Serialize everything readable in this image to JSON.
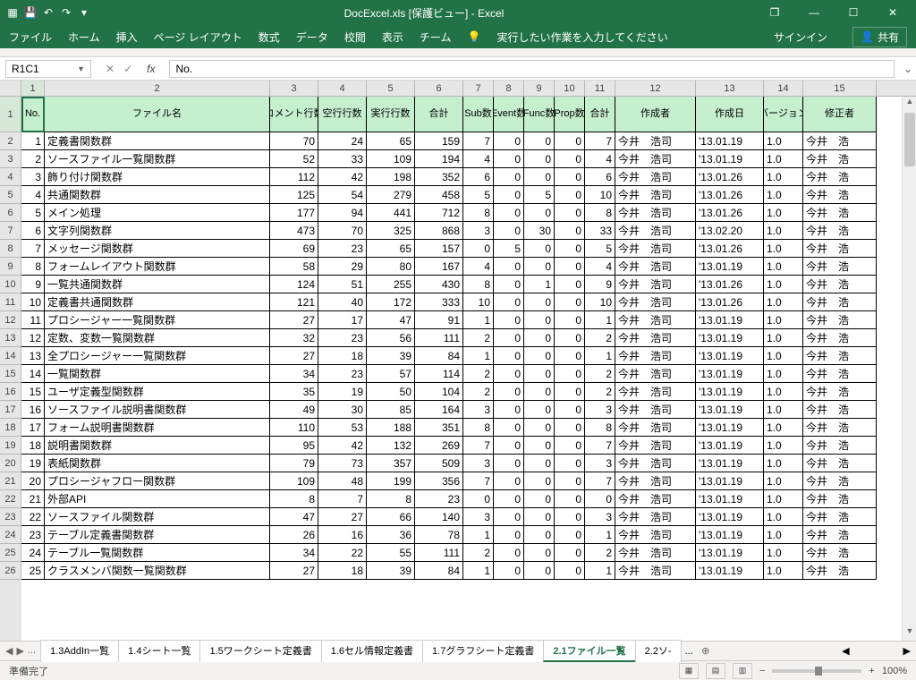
{
  "title": "DocExcel.xls  [保護ビュー] - Excel",
  "window": {
    "restore": "❐",
    "minimize": "—",
    "maximize": "☐",
    "close": "✕"
  },
  "qat": {
    "save": "💾",
    "undo": "↶",
    "redo": "↷",
    "dropdown": "▾"
  },
  "ribbon": {
    "tabs": [
      "ファイル",
      "ホーム",
      "挿入",
      "ページ レイアウト",
      "数式",
      "データ",
      "校閲",
      "表示",
      "チーム"
    ],
    "tell_me_icon": "💡",
    "tell_me": "実行したい作業を入力してください",
    "signin": "サインイン",
    "share_icon": "👤",
    "share": "共有"
  },
  "namebox": "R1C1",
  "fx": {
    "cancel": "✕",
    "enter": "✓",
    "label": "fx"
  },
  "formula": "No.",
  "col_labels": [
    "1",
    "2",
    "3",
    "4",
    "5",
    "6",
    "7",
    "8",
    "9",
    "10",
    "11",
    "12",
    "13",
    "14",
    "15"
  ],
  "headers": {
    "no": "No.",
    "name": "ファイル名",
    "comment": "コメント行数",
    "empty": "空行行数",
    "exec": "実行行数",
    "total": "合計",
    "sub": "Sub数",
    "event": "Event数",
    "func": "Func数",
    "prop": "Prop数",
    "total2": "合計",
    "author": "作成者",
    "date": "作成日",
    "ver": "バージョン",
    "modifier": "修正者"
  },
  "chart_data": {
    "type": "table",
    "columns": [
      "No.",
      "ファイル名",
      "コメント行数",
      "空行行数",
      "実行行数",
      "合計",
      "Sub数",
      "Event数",
      "Func数",
      "Prop数",
      "合計",
      "作成者",
      "作成日",
      "バージョン",
      "修正者"
    ],
    "rows": [
      [
        1,
        "定義書関数群",
        70,
        24,
        65,
        159,
        7,
        0,
        0,
        0,
        7,
        "今井　浩司",
        "'13.01.19",
        "1.0",
        "今井　浩"
      ],
      [
        2,
        "ソースファイル一覧関数群",
        52,
        33,
        109,
        194,
        4,
        0,
        0,
        0,
        4,
        "今井　浩司",
        "'13.01.19",
        "1.0",
        "今井　浩"
      ],
      [
        3,
        "飾り付け関数群",
        112,
        42,
        198,
        352,
        6,
        0,
        0,
        0,
        6,
        "今井　浩司",
        "'13.01.26",
        "1.0",
        "今井　浩"
      ],
      [
        4,
        "共通関数群",
        125,
        54,
        279,
        458,
        5,
        0,
        5,
        0,
        10,
        "今井　浩司",
        "'13.01.26",
        "1.0",
        "今井　浩"
      ],
      [
        5,
        "メイン処理",
        177,
        94,
        441,
        712,
        8,
        0,
        0,
        0,
        8,
        "今井　浩司",
        "'13.01.26",
        "1.0",
        "今井　浩"
      ],
      [
        6,
        "文字列関数群",
        473,
        70,
        325,
        868,
        3,
        0,
        30,
        0,
        33,
        "今井　浩司",
        "'13.02.20",
        "1.0",
        "今井　浩"
      ],
      [
        7,
        "メッセージ関数群",
        69,
        23,
        65,
        157,
        0,
        5,
        0,
        0,
        5,
        "今井　浩司",
        "'13.01.26",
        "1.0",
        "今井　浩"
      ],
      [
        8,
        "フォームレイアウト関数群",
        58,
        29,
        80,
        167,
        4,
        0,
        0,
        0,
        4,
        "今井　浩司",
        "'13.01.19",
        "1.0",
        "今井　浩"
      ],
      [
        9,
        "一覧共通関数群",
        124,
        51,
        255,
        430,
        8,
        0,
        1,
        0,
        9,
        "今井　浩司",
        "'13.01.26",
        "1.0",
        "今井　浩"
      ],
      [
        10,
        "定義書共通関数群",
        121,
        40,
        172,
        333,
        10,
        0,
        0,
        0,
        10,
        "今井　浩司",
        "'13.01.26",
        "1.0",
        "今井　浩"
      ],
      [
        11,
        "プロシージャー一覧関数群",
        27,
        17,
        47,
        91,
        1,
        0,
        0,
        0,
        1,
        "今井　浩司",
        "'13.01.19",
        "1.0",
        "今井　浩"
      ],
      [
        12,
        "定数、変数一覧関数群",
        32,
        23,
        56,
        111,
        2,
        0,
        0,
        0,
        2,
        "今井　浩司",
        "'13.01.19",
        "1.0",
        "今井　浩"
      ],
      [
        13,
        "全プロシージャー一覧関数群",
        27,
        18,
        39,
        84,
        1,
        0,
        0,
        0,
        1,
        "今井　浩司",
        "'13.01.19",
        "1.0",
        "今井　浩"
      ],
      [
        14,
        "一覧関数群",
        34,
        23,
        57,
        114,
        2,
        0,
        0,
        0,
        2,
        "今井　浩司",
        "'13.01.19",
        "1.0",
        "今井　浩"
      ],
      [
        15,
        "ユーザ定義型関数群",
        35,
        19,
        50,
        104,
        2,
        0,
        0,
        0,
        2,
        "今井　浩司",
        "'13.01.19",
        "1.0",
        "今井　浩"
      ],
      [
        16,
        "ソースファイル説明書関数群",
        49,
        30,
        85,
        164,
        3,
        0,
        0,
        0,
        3,
        "今井　浩司",
        "'13.01.19",
        "1.0",
        "今井　浩"
      ],
      [
        17,
        "フォーム説明書関数群",
        110,
        53,
        188,
        351,
        8,
        0,
        0,
        0,
        8,
        "今井　浩司",
        "'13.01.19",
        "1.0",
        "今井　浩"
      ],
      [
        18,
        "説明書関数群",
        95,
        42,
        132,
        269,
        7,
        0,
        0,
        0,
        7,
        "今井　浩司",
        "'13.01.19",
        "1.0",
        "今井　浩"
      ],
      [
        19,
        "表紙関数群",
        79,
        73,
        357,
        509,
        3,
        0,
        0,
        0,
        3,
        "今井　浩司",
        "'13.01.19",
        "1.0",
        "今井　浩"
      ],
      [
        20,
        "プロシージャフロー関数群",
        109,
        48,
        199,
        356,
        7,
        0,
        0,
        0,
        7,
        "今井　浩司",
        "'13.01.19",
        "1.0",
        "今井　浩"
      ],
      [
        21,
        "外部API",
        8,
        7,
        8,
        23,
        0,
        0,
        0,
        0,
        0,
        "今井　浩司",
        "'13.01.19",
        "1.0",
        "今井　浩"
      ],
      [
        22,
        "ソースファイル関数群",
        47,
        27,
        66,
        140,
        3,
        0,
        0,
        0,
        3,
        "今井　浩司",
        "'13.01.19",
        "1.0",
        "今井　浩"
      ],
      [
        23,
        "テーブル定義書関数群",
        26,
        16,
        36,
        78,
        1,
        0,
        0,
        0,
        1,
        "今井　浩司",
        "'13.01.19",
        "1.0",
        "今井　浩"
      ],
      [
        24,
        "テーブル一覧関数群",
        34,
        22,
        55,
        111,
        2,
        0,
        0,
        0,
        2,
        "今井　浩司",
        "'13.01.19",
        "1.0",
        "今井　浩"
      ],
      [
        25,
        "クラスメンバ関数一覧関数群",
        27,
        18,
        39,
        84,
        1,
        0,
        0,
        0,
        1,
        "今井　浩司",
        "'13.01.19",
        "1.0",
        "今井　浩"
      ]
    ]
  },
  "sheet_tabs": {
    "ellipsis": "...",
    "tabs": [
      "1.3AddIn一覧",
      "1.4シート一覧",
      "1.5ワークシート定義書",
      "1.6セル情報定義書",
      "1.7グラフシート定義書",
      "2.1ファイル一覧",
      "2.2ソ-"
    ],
    "ellipsis2": "...",
    "active": 5,
    "add": "⊕"
  },
  "status": {
    "ready": "準備完了",
    "zoom": "100%",
    "minus": "−",
    "plus": "+"
  }
}
